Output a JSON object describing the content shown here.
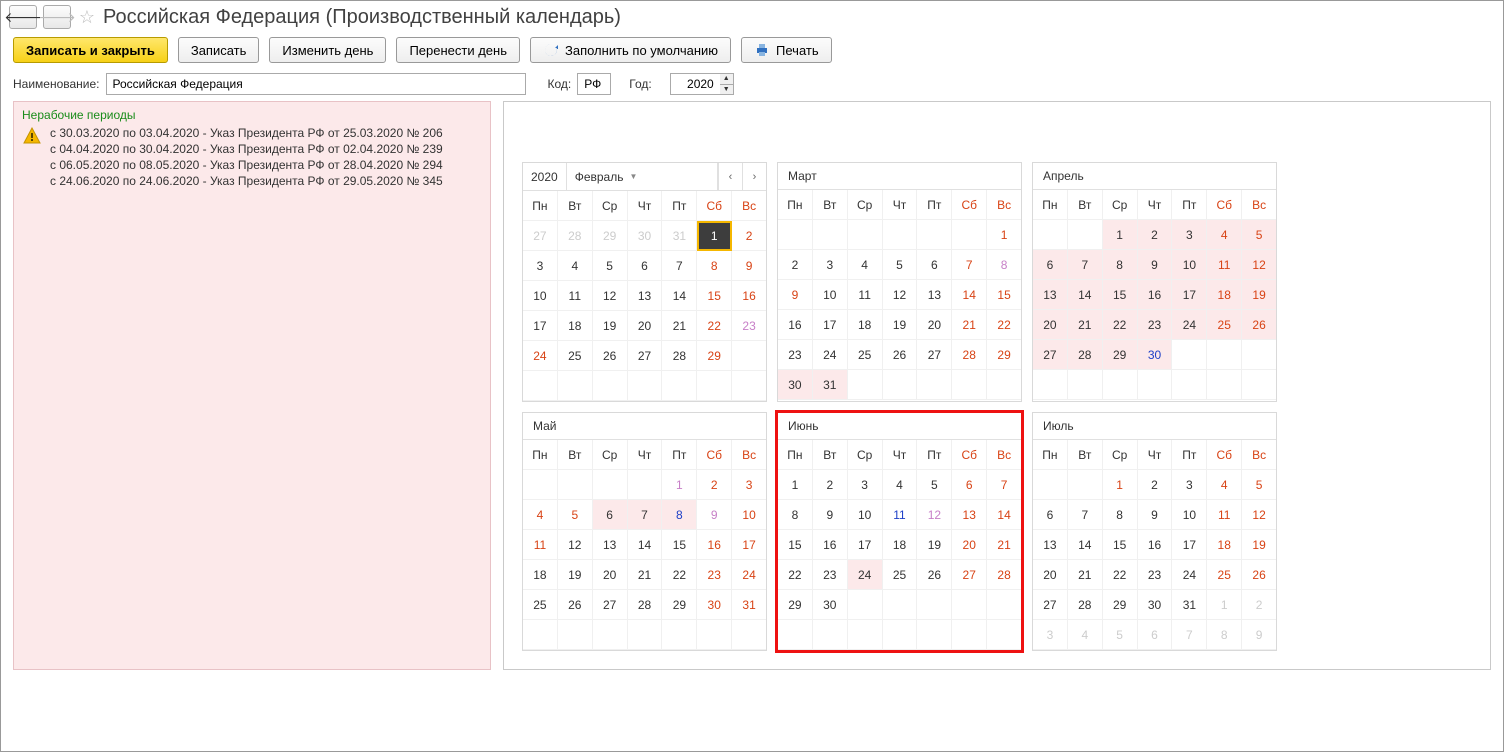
{
  "header": {
    "title": "Российская Федерация (Производственный календарь)"
  },
  "toolbar": {
    "save_close": "Записать и закрыть",
    "save": "Записать",
    "change_day": "Изменить день",
    "move_day": "Перенести день",
    "fill_default": "Заполнить по умолчанию",
    "print": "Печать"
  },
  "fields": {
    "name_label": "Наименование:",
    "name_value": "Российская Федерация",
    "code_label": "Код:",
    "code_value": "РФ",
    "year_label": "Год:",
    "year_value": "2020"
  },
  "notice": {
    "title": "Нерабочие периоды",
    "lines": [
      "с 30.03.2020 по 03.04.2020 - Указ Президента РФ от 25.03.2020 № 206",
      "с 04.04.2020 по 30.04.2020 - Указ Президента РФ от 02.04.2020 № 239",
      "с 06.05.2020 по 08.05.2020 - Указ Президента РФ от 28.04.2020 № 294",
      "с 24.06.2020 по 24.06.2020 - Указ Президента РФ от 29.05.2020 № 345"
    ]
  },
  "dow": [
    "Пн",
    "Вт",
    "Ср",
    "Чт",
    "Пт",
    "Сб",
    "Вс"
  ],
  "months": [
    {
      "id": "feb",
      "name": "Февраль",
      "year": "2020",
      "controls": true,
      "highlight": false,
      "weeks": [
        [
          {
            "n": "27",
            "cls": "day-other"
          },
          {
            "n": "28",
            "cls": "day-other"
          },
          {
            "n": "29",
            "cls": "day-other"
          },
          {
            "n": "30",
            "cls": "day-other"
          },
          {
            "n": "31",
            "cls": "day-other"
          },
          {
            "n": "1",
            "cls": "day-selected"
          },
          {
            "n": "2",
            "cls": "day-holiday"
          }
        ],
        [
          {
            "n": "3"
          },
          {
            "n": "4"
          },
          {
            "n": "5"
          },
          {
            "n": "6"
          },
          {
            "n": "7"
          },
          {
            "n": "8",
            "cls": "day-holiday"
          },
          {
            "n": "9",
            "cls": "day-holiday"
          }
        ],
        [
          {
            "n": "10"
          },
          {
            "n": "11"
          },
          {
            "n": "12"
          },
          {
            "n": "13"
          },
          {
            "n": "14"
          },
          {
            "n": "15",
            "cls": "day-holiday"
          },
          {
            "n": "16",
            "cls": "day-holiday"
          }
        ],
        [
          {
            "n": "17"
          },
          {
            "n": "18"
          },
          {
            "n": "19"
          },
          {
            "n": "20"
          },
          {
            "n": "21"
          },
          {
            "n": "22",
            "cls": "day-holiday"
          },
          {
            "n": "23",
            "cls": "day-special"
          }
        ],
        [
          {
            "n": "24",
            "cls": "day-holiday"
          },
          {
            "n": "25"
          },
          {
            "n": "26"
          },
          {
            "n": "27"
          },
          {
            "n": "28"
          },
          {
            "n": "29",
            "cls": "day-holiday"
          },
          {
            "n": ""
          }
        ],
        [
          {
            "n": ""
          },
          {
            "n": ""
          },
          {
            "n": ""
          },
          {
            "n": ""
          },
          {
            "n": ""
          },
          {
            "n": ""
          },
          {
            "n": ""
          }
        ]
      ]
    },
    {
      "id": "mar",
      "name": "Март",
      "controls": false,
      "highlight": false,
      "weeks": [
        [
          {
            "n": ""
          },
          {
            "n": ""
          },
          {
            "n": ""
          },
          {
            "n": ""
          },
          {
            "n": ""
          },
          {
            "n": ""
          },
          {
            "n": "1",
            "cls": "day-holiday"
          }
        ],
        [
          {
            "n": "2"
          },
          {
            "n": "3"
          },
          {
            "n": "4"
          },
          {
            "n": "5"
          },
          {
            "n": "6"
          },
          {
            "n": "7",
            "cls": "day-holiday"
          },
          {
            "n": "8",
            "cls": "day-special"
          }
        ],
        [
          {
            "n": "9",
            "cls": "day-holiday"
          },
          {
            "n": "10"
          },
          {
            "n": "11"
          },
          {
            "n": "12"
          },
          {
            "n": "13"
          },
          {
            "n": "14",
            "cls": "day-holiday"
          },
          {
            "n": "15",
            "cls": "day-holiday"
          }
        ],
        [
          {
            "n": "16"
          },
          {
            "n": "17"
          },
          {
            "n": "18"
          },
          {
            "n": "19"
          },
          {
            "n": "20"
          },
          {
            "n": "21",
            "cls": "day-holiday"
          },
          {
            "n": "22",
            "cls": "day-holiday"
          }
        ],
        [
          {
            "n": "23"
          },
          {
            "n": "24"
          },
          {
            "n": "25"
          },
          {
            "n": "26"
          },
          {
            "n": "27"
          },
          {
            "n": "28",
            "cls": "day-holiday"
          },
          {
            "n": "29",
            "cls": "day-holiday"
          }
        ],
        [
          {
            "n": "30",
            "cls": "day-nonwork"
          },
          {
            "n": "31",
            "cls": "day-nonwork"
          },
          {
            "n": ""
          },
          {
            "n": ""
          },
          {
            "n": ""
          },
          {
            "n": ""
          },
          {
            "n": ""
          }
        ]
      ]
    },
    {
      "id": "apr",
      "name": "Апрель",
      "controls": false,
      "highlight": false,
      "weeks": [
        [
          {
            "n": ""
          },
          {
            "n": ""
          },
          {
            "n": "1",
            "cls": "day-nonwork"
          },
          {
            "n": "2",
            "cls": "day-nonwork"
          },
          {
            "n": "3",
            "cls": "day-nonwork"
          },
          {
            "n": "4",
            "cls": "day-holiday day-nonwork"
          },
          {
            "n": "5",
            "cls": "day-holiday day-nonwork"
          }
        ],
        [
          {
            "n": "6",
            "cls": "day-nonwork"
          },
          {
            "n": "7",
            "cls": "day-nonwork"
          },
          {
            "n": "8",
            "cls": "day-nonwork"
          },
          {
            "n": "9",
            "cls": "day-nonwork"
          },
          {
            "n": "10",
            "cls": "day-nonwork"
          },
          {
            "n": "11",
            "cls": "day-holiday day-nonwork"
          },
          {
            "n": "12",
            "cls": "day-holiday day-nonwork"
          }
        ],
        [
          {
            "n": "13",
            "cls": "day-nonwork"
          },
          {
            "n": "14",
            "cls": "day-nonwork"
          },
          {
            "n": "15",
            "cls": "day-nonwork"
          },
          {
            "n": "16",
            "cls": "day-nonwork"
          },
          {
            "n": "17",
            "cls": "day-nonwork"
          },
          {
            "n": "18",
            "cls": "day-holiday day-nonwork"
          },
          {
            "n": "19",
            "cls": "day-holiday day-nonwork"
          }
        ],
        [
          {
            "n": "20",
            "cls": "day-nonwork"
          },
          {
            "n": "21",
            "cls": "day-nonwork"
          },
          {
            "n": "22",
            "cls": "day-nonwork"
          },
          {
            "n": "23",
            "cls": "day-nonwork"
          },
          {
            "n": "24",
            "cls": "day-nonwork"
          },
          {
            "n": "25",
            "cls": "day-holiday day-nonwork"
          },
          {
            "n": "26",
            "cls": "day-holiday day-nonwork"
          }
        ],
        [
          {
            "n": "27",
            "cls": "day-nonwork"
          },
          {
            "n": "28",
            "cls": "day-nonwork"
          },
          {
            "n": "29",
            "cls": "day-nonwork"
          },
          {
            "n": "30",
            "cls": "day-preholiday day-nonwork"
          },
          {
            "n": ""
          },
          {
            "n": ""
          },
          {
            "n": ""
          }
        ],
        [
          {
            "n": ""
          },
          {
            "n": ""
          },
          {
            "n": ""
          },
          {
            "n": ""
          },
          {
            "n": ""
          },
          {
            "n": ""
          },
          {
            "n": ""
          }
        ]
      ]
    },
    {
      "id": "may",
      "name": "Май",
      "controls": false,
      "highlight": false,
      "weeks": [
        [
          {
            "n": ""
          },
          {
            "n": ""
          },
          {
            "n": ""
          },
          {
            "n": ""
          },
          {
            "n": "1",
            "cls": "day-special"
          },
          {
            "n": "2",
            "cls": "day-holiday"
          },
          {
            "n": "3",
            "cls": "day-holiday"
          }
        ],
        [
          {
            "n": "4",
            "cls": "day-holiday"
          },
          {
            "n": "5",
            "cls": "day-holiday"
          },
          {
            "n": "6",
            "cls": "day-nonwork"
          },
          {
            "n": "7",
            "cls": "day-nonwork"
          },
          {
            "n": "8",
            "cls": "day-preholiday day-nonwork"
          },
          {
            "n": "9",
            "cls": "day-special"
          },
          {
            "n": "10",
            "cls": "day-holiday"
          }
        ],
        [
          {
            "n": "11",
            "cls": "day-holiday"
          },
          {
            "n": "12"
          },
          {
            "n": "13"
          },
          {
            "n": "14"
          },
          {
            "n": "15"
          },
          {
            "n": "16",
            "cls": "day-holiday"
          },
          {
            "n": "17",
            "cls": "day-holiday"
          }
        ],
        [
          {
            "n": "18"
          },
          {
            "n": "19"
          },
          {
            "n": "20"
          },
          {
            "n": "21"
          },
          {
            "n": "22"
          },
          {
            "n": "23",
            "cls": "day-holiday"
          },
          {
            "n": "24",
            "cls": "day-holiday"
          }
        ],
        [
          {
            "n": "25"
          },
          {
            "n": "26"
          },
          {
            "n": "27"
          },
          {
            "n": "28"
          },
          {
            "n": "29"
          },
          {
            "n": "30",
            "cls": "day-holiday"
          },
          {
            "n": "31",
            "cls": "day-holiday"
          }
        ],
        [
          {
            "n": ""
          },
          {
            "n": ""
          },
          {
            "n": ""
          },
          {
            "n": ""
          },
          {
            "n": ""
          },
          {
            "n": ""
          },
          {
            "n": ""
          }
        ]
      ]
    },
    {
      "id": "jun",
      "name": "Июнь",
      "controls": false,
      "highlight": true,
      "weeks": [
        [
          {
            "n": "1"
          },
          {
            "n": "2"
          },
          {
            "n": "3"
          },
          {
            "n": "4"
          },
          {
            "n": "5"
          },
          {
            "n": "6",
            "cls": "day-holiday"
          },
          {
            "n": "7",
            "cls": "day-holiday"
          }
        ],
        [
          {
            "n": "8"
          },
          {
            "n": "9"
          },
          {
            "n": "10"
          },
          {
            "n": "11",
            "cls": "day-preholiday"
          },
          {
            "n": "12",
            "cls": "day-special"
          },
          {
            "n": "13",
            "cls": "day-holiday"
          },
          {
            "n": "14",
            "cls": "day-holiday"
          }
        ],
        [
          {
            "n": "15"
          },
          {
            "n": "16"
          },
          {
            "n": "17"
          },
          {
            "n": "18"
          },
          {
            "n": "19"
          },
          {
            "n": "20",
            "cls": "day-holiday"
          },
          {
            "n": "21",
            "cls": "day-holiday"
          }
        ],
        [
          {
            "n": "22"
          },
          {
            "n": "23"
          },
          {
            "n": "24",
            "cls": "day-nonwork"
          },
          {
            "n": "25"
          },
          {
            "n": "26"
          },
          {
            "n": "27",
            "cls": "day-holiday"
          },
          {
            "n": "28",
            "cls": "day-holiday"
          }
        ],
        [
          {
            "n": "29"
          },
          {
            "n": "30"
          },
          {
            "n": ""
          },
          {
            "n": ""
          },
          {
            "n": ""
          },
          {
            "n": ""
          },
          {
            "n": ""
          }
        ],
        [
          {
            "n": ""
          },
          {
            "n": ""
          },
          {
            "n": ""
          },
          {
            "n": ""
          },
          {
            "n": ""
          },
          {
            "n": ""
          },
          {
            "n": ""
          }
        ]
      ]
    },
    {
      "id": "jul",
      "name": "Июль",
      "controls": false,
      "highlight": false,
      "weeks": [
        [
          {
            "n": ""
          },
          {
            "n": ""
          },
          {
            "n": "1",
            "cls": "day-holiday"
          },
          {
            "n": "2"
          },
          {
            "n": "3"
          },
          {
            "n": "4",
            "cls": "day-holiday"
          },
          {
            "n": "5",
            "cls": "day-holiday"
          }
        ],
        [
          {
            "n": "6"
          },
          {
            "n": "7"
          },
          {
            "n": "8"
          },
          {
            "n": "9"
          },
          {
            "n": "10"
          },
          {
            "n": "11",
            "cls": "day-holiday"
          },
          {
            "n": "12",
            "cls": "day-holiday"
          }
        ],
        [
          {
            "n": "13"
          },
          {
            "n": "14"
          },
          {
            "n": "15"
          },
          {
            "n": "16"
          },
          {
            "n": "17"
          },
          {
            "n": "18",
            "cls": "day-holiday"
          },
          {
            "n": "19",
            "cls": "day-holiday"
          }
        ],
        [
          {
            "n": "20"
          },
          {
            "n": "21"
          },
          {
            "n": "22"
          },
          {
            "n": "23"
          },
          {
            "n": "24"
          },
          {
            "n": "25",
            "cls": "day-holiday"
          },
          {
            "n": "26",
            "cls": "day-holiday"
          }
        ],
        [
          {
            "n": "27"
          },
          {
            "n": "28"
          },
          {
            "n": "29"
          },
          {
            "n": "30"
          },
          {
            "n": "31"
          },
          {
            "n": "1",
            "cls": "day-other"
          },
          {
            "n": "2",
            "cls": "day-other"
          }
        ],
        [
          {
            "n": "3",
            "cls": "day-other"
          },
          {
            "n": "4",
            "cls": "day-other"
          },
          {
            "n": "5",
            "cls": "day-other"
          },
          {
            "n": "6",
            "cls": "day-other"
          },
          {
            "n": "7",
            "cls": "day-other"
          },
          {
            "n": "8",
            "cls": "day-other"
          },
          {
            "n": "9",
            "cls": "day-other"
          }
        ]
      ]
    }
  ]
}
